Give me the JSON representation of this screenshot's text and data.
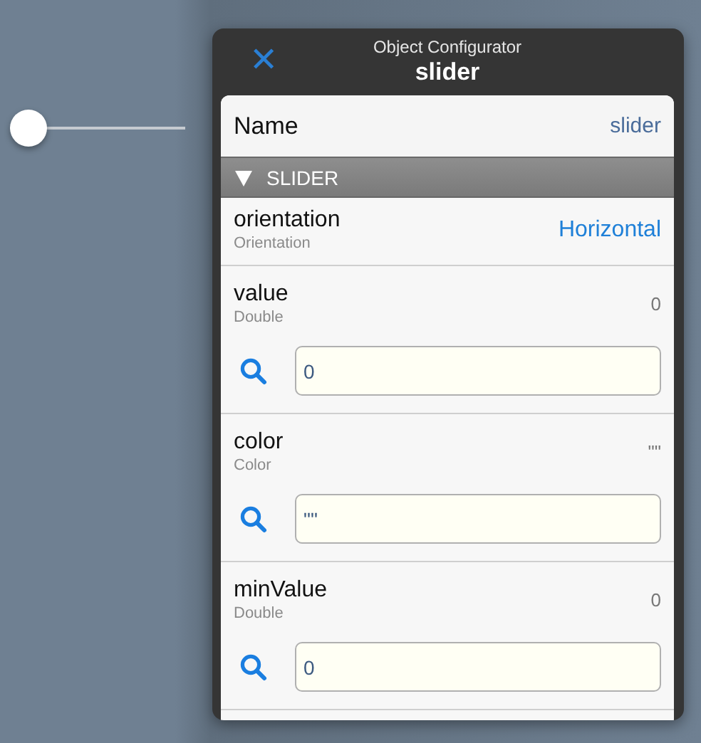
{
  "canvas_slider": {
    "level": 0
  },
  "panel": {
    "subtitle": "Object Configurator",
    "title": "slider",
    "close": "✕"
  },
  "name_row": {
    "label": "Name",
    "value": "slider"
  },
  "section": {
    "label": "SLIDER",
    "expanded": true
  },
  "properties": [
    {
      "kind": "choice",
      "name": "orientation",
      "type": "Orientation",
      "value": "Horizontal"
    },
    {
      "kind": "field",
      "name": "value",
      "type": "Double",
      "value": "0",
      "input": "0"
    },
    {
      "kind": "field",
      "name": "color",
      "type": "Color",
      "value": "\"\"",
      "input": "\"\""
    },
    {
      "kind": "field",
      "name": "minValue",
      "type": "Double",
      "value": "0",
      "input": "0"
    }
  ]
}
